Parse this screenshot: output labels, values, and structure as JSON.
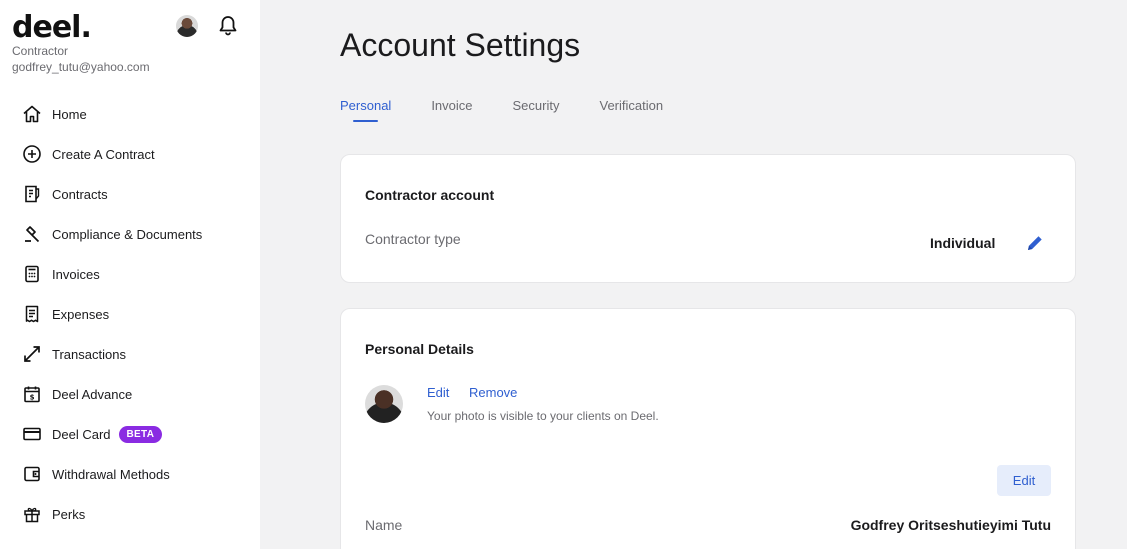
{
  "sidebar": {
    "logo": "deel.",
    "role": "Contractor",
    "email": "godfrey_tutu@yahoo.com",
    "items": [
      {
        "label": "Home",
        "icon": "home-icon"
      },
      {
        "label": "Create A Contract",
        "icon": "plus-circle-icon"
      },
      {
        "label": "Contracts",
        "icon": "contract-icon"
      },
      {
        "label": "Compliance & Documents",
        "icon": "gavel-icon"
      },
      {
        "label": "Invoices",
        "icon": "calculator-icon"
      },
      {
        "label": "Expenses",
        "icon": "receipt-icon"
      },
      {
        "label": "Transactions",
        "icon": "arrows-icon"
      },
      {
        "label": "Deel Advance",
        "icon": "calendar-dollar-icon"
      },
      {
        "label": "Deel Card",
        "icon": "card-icon",
        "badge": "BETA"
      },
      {
        "label": "Withdrawal Methods",
        "icon": "wallet-icon"
      },
      {
        "label": "Perks",
        "icon": "gift-icon"
      }
    ]
  },
  "main": {
    "title": "Account Settings",
    "tabs": [
      {
        "label": "Personal",
        "active": true
      },
      {
        "label": "Invoice",
        "active": false
      },
      {
        "label": "Security",
        "active": false
      },
      {
        "label": "Verification",
        "active": false
      }
    ],
    "contractor_account": {
      "title": "Contractor account",
      "type_label": "Contractor type",
      "type_value": "Individual"
    },
    "personal_details": {
      "title": "Personal Details",
      "photo_edit": "Edit",
      "photo_remove": "Remove",
      "photo_hint": "Your photo is visible to your clients on Deel.",
      "edit_button": "Edit",
      "name_label": "Name",
      "name_value": "Godfrey Oritseshutieyimi Tutu"
    }
  },
  "colors": {
    "accent": "#2f5fd0",
    "badge": "#8a2be2",
    "background": "#f2f2f3"
  }
}
